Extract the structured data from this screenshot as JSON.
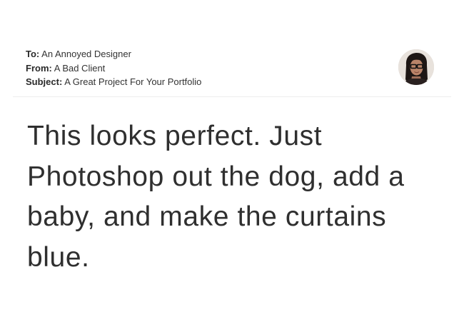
{
  "email": {
    "to_label": "To:",
    "to_value": "An Annoyed Designer",
    "from_label": "From:",
    "from_value": "A Bad Client",
    "subject_label": "Subject:",
    "subject_value": "A Great Project For Your Portfolio",
    "avatar_icon": "profile-photo-woman-with-glasses",
    "body_lines": [
      "This looks perfect. Just",
      "Photoshop out the dog, add a",
      "baby, and make the curtains",
      "blue."
    ]
  }
}
